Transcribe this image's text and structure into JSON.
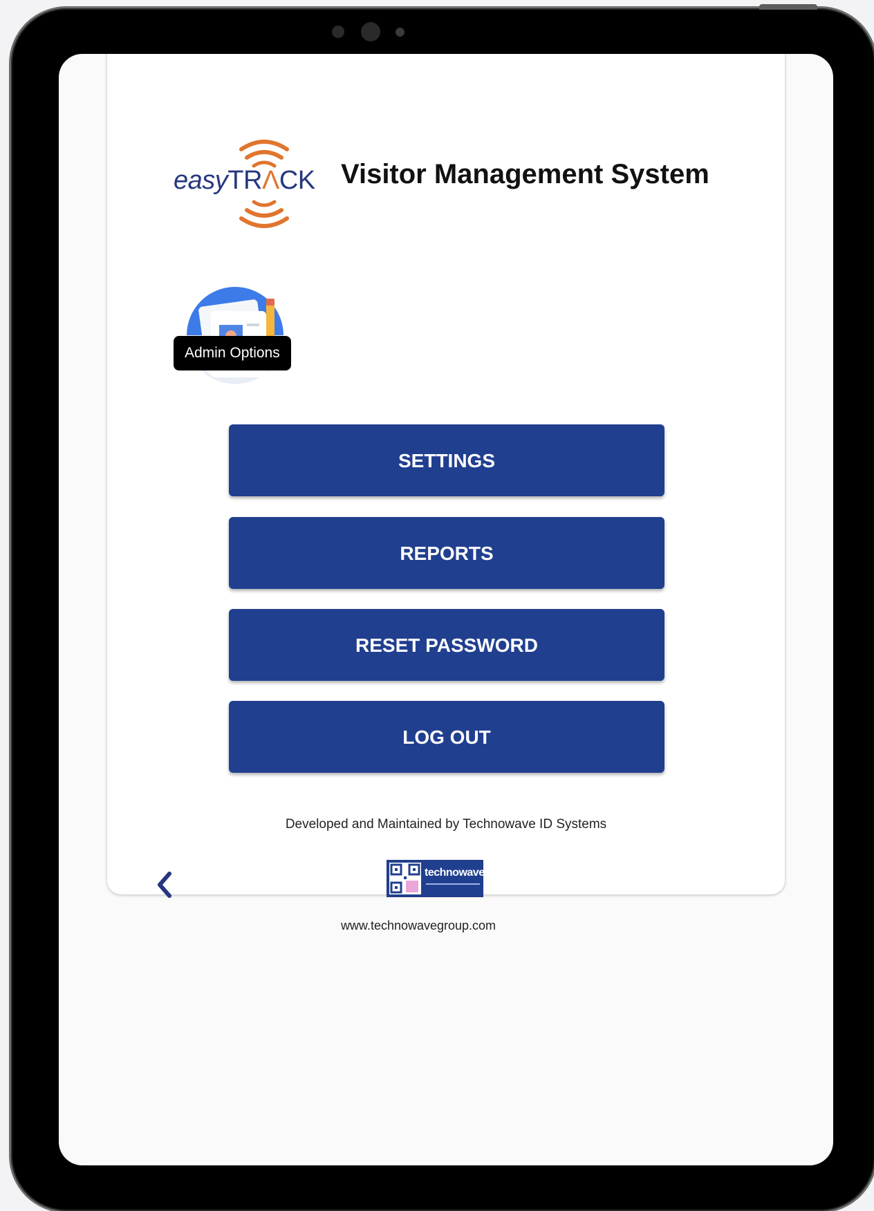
{
  "app": {
    "logo_brand_text": "easyTRACK",
    "title": "Visitor Management System"
  },
  "admin": {
    "icon": "admin-id-card-icon",
    "tooltip": "Admin Options"
  },
  "menu": {
    "settings_label": "SETTINGS",
    "reports_label": "REPORTS",
    "reset_password_label": "RESET PASSWORD",
    "logout_label": "LOG OUT"
  },
  "footer": {
    "developer_text": "Developed and Maintained by Technowave ID Systems",
    "partner_logo_text": "technowave",
    "website": "www.technowavegroup.com",
    "back_icon": "chevron-left-icon"
  },
  "colors": {
    "primary": "#213f8f",
    "brand_blue": "#26377e",
    "brand_orange": "#e0752e",
    "tooltip_bg": "#000000",
    "device_frame": "#000000"
  }
}
